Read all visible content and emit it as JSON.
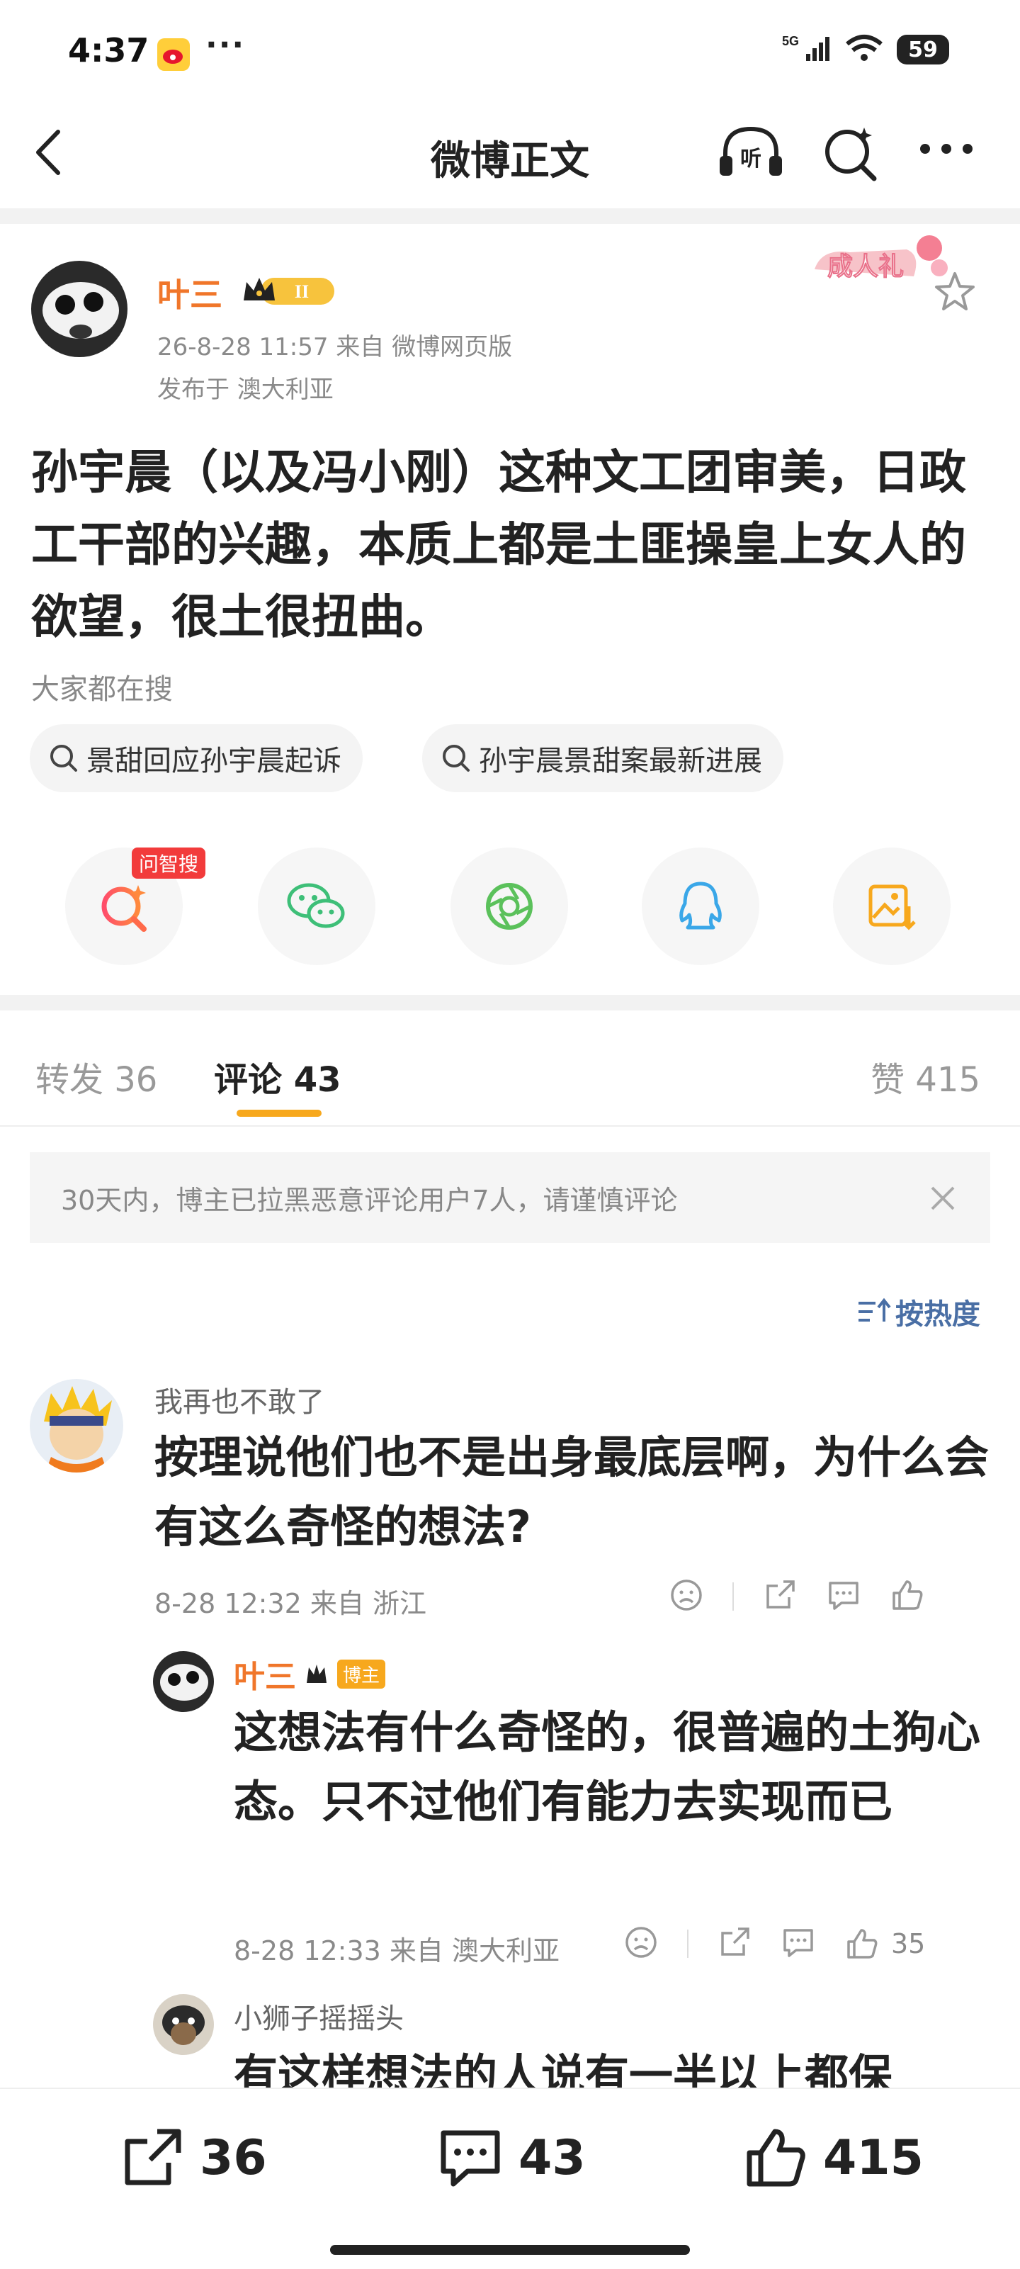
{
  "status_bar": {
    "time": "4:37",
    "dots": "···",
    "signal": "5G",
    "battery": "59"
  },
  "nav": {
    "title": "微博正文"
  },
  "post": {
    "author": "叶三",
    "level_badge": "II",
    "sticker": "成人礼",
    "date_source": "26-8-28 11:57  来自 微博网页版",
    "location": "发布于 澳大利亚",
    "body": "孙宇晨（以及冯小刚）这种文工团审美，日政工干部的兴趣，本质上都是土匪操皇上女人的欲望，很土很扭曲。"
  },
  "hot_search": {
    "label": "大家都在搜",
    "chips": [
      "景甜回应孙宇晨起诉",
      "孙宇晨景甜案最新进展"
    ]
  },
  "share": {
    "badge": "问智搜"
  },
  "tabs": {
    "repost": "转发 36",
    "comment": "评论 43",
    "like": "赞 415"
  },
  "notice": "30天内，博主已拉黑恶意评论用户7人，请谨慎评论",
  "sort_label": "按热度",
  "comments": [
    {
      "name": "我再也不敢了",
      "text": "按理说他们也不是出身最底层啊，为什么会有这么奇怪的想法?",
      "meta": "8-28 12:32  来自 浙江"
    },
    {
      "name": "叶三",
      "tag": "博主",
      "text": "这想法有什么奇怪的，很普遍的土狗心态。只不过他们有能力去实现而已",
      "meta": "8-28 12:33  来自 澳大利亚",
      "likes": "35"
    },
    {
      "name": "小狮子摇摇头",
      "text": "有这样想法的人说有一半以上都保"
    }
  ],
  "bottom_bar": {
    "repost": "36",
    "comment": "43",
    "like": "415"
  },
  "colors": {
    "accent_orange": "#f0762a",
    "tab_underline": "#f7a81d",
    "link_blue": "#4a6fa5"
  }
}
